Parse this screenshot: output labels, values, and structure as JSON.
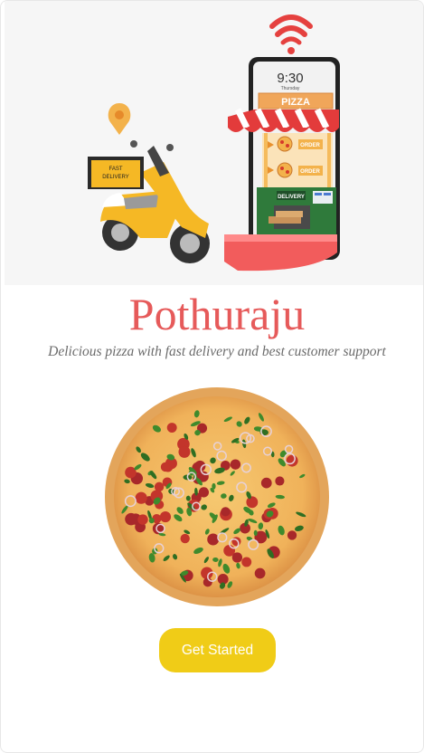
{
  "hero": {
    "phone": {
      "time": "9:30",
      "day": "Thursday",
      "sign_label": "PIZZA",
      "order_label": "ORDER",
      "delivery_label": "DELIVERY"
    },
    "scooter": {
      "box_label_1": "FAST",
      "box_label_2": "DELIVERY"
    }
  },
  "brand": {
    "title": "Pothuraju",
    "tagline": "Delicious pizza with fast delivery and best customer support"
  },
  "cta": {
    "label": "Get Started"
  },
  "colors": {
    "accent": "#e65a5a",
    "button": "#f0cc17",
    "hero_bg": "#f6f6f6"
  },
  "icons": [
    "wifi-icon",
    "location-pin-icon"
  ]
}
